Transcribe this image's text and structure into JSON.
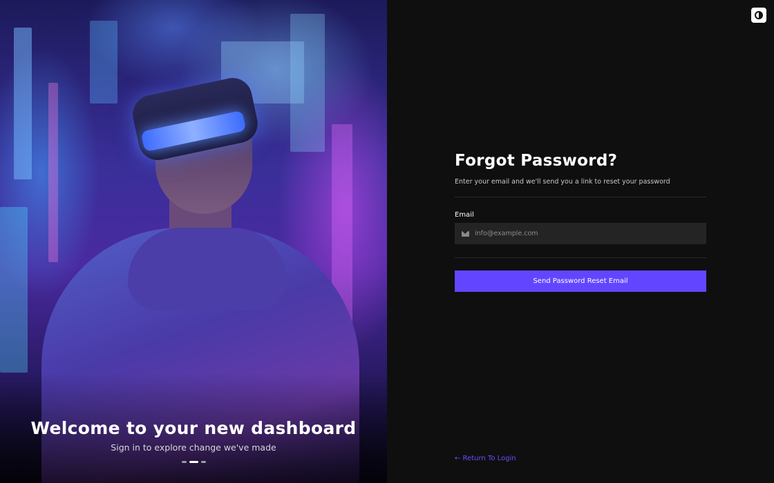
{
  "hero": {
    "title": "Welcome to your new dashboard",
    "subtitle": "Sign in to explore change we've made",
    "slides": [
      {
        "active": false
      },
      {
        "active": true
      },
      {
        "active": false
      }
    ]
  },
  "theme_toggle": {
    "icon": "contrast-icon"
  },
  "form": {
    "title": "Forgot Password?",
    "subtitle": "Enter your email and we'll send you a link to reset your password",
    "email_label": "Email",
    "email_placeholder": "info@example.com",
    "email_value": "",
    "email_icon": "mail-icon",
    "submit_label": "Send Password Reset Email"
  },
  "footer": {
    "return_link": "← Return To Login"
  },
  "colors": {
    "accent": "#6246ff",
    "link": "#6b4dff",
    "background": "#0f0f0f",
    "input_bg": "#242424"
  }
}
